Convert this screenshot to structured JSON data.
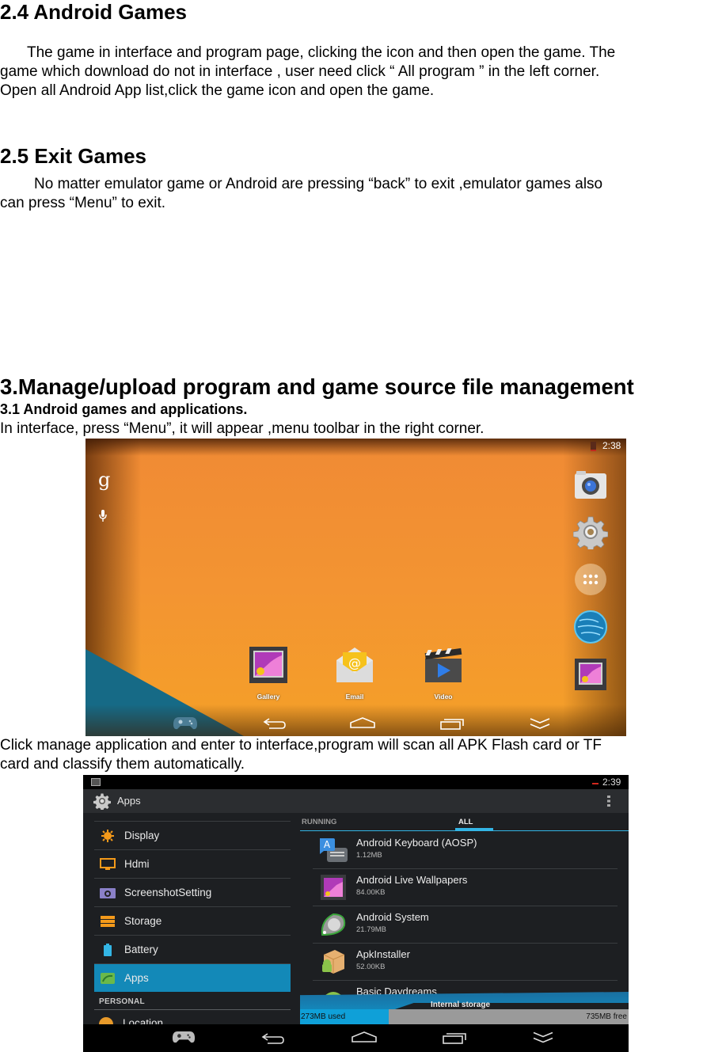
{
  "section_2_4": {
    "heading": "2.4 Android Games",
    "lines": [
      "The game in interface and program page, clicking the icon and then open the game. The",
      "game which download do not in interface , user need click “ All program ” in the left corner.",
      "Open all Android App list,click the game icon and open the game."
    ]
  },
  "section_2_5": {
    "heading": "2.5 Exit Games",
    "lines": [
      "No matter emulator game or Android are pressing “back” to exit ,emulator games also",
      "can press “Menu” to exit."
    ]
  },
  "section_3": {
    "heading": "3.Manage/upload program and game source file management",
    "sub_heading": "3.1 Android games and applications.",
    "intro": "In interface, press “Menu”, it will appear ,menu toolbar in the right corner.",
    "after_shot1_lines": [
      "Click manage application and enter to interface,program will scan all APK Flash card or TF",
      "card and classify them automatically."
    ]
  },
  "screenshot_home": {
    "status_time": "2:38",
    "left_icons": [
      "google-search-icon",
      "mic-icon"
    ],
    "dock": [
      {
        "label": "Gallery",
        "icon": "gallery-icon"
      },
      {
        "label": "Email",
        "icon": "email-icon"
      },
      {
        "label": "Video",
        "icon": "video-icon"
      }
    ],
    "side_icons": [
      "camera-icon",
      "settings-icon",
      "all-apps-icon",
      "browser-globe-icon",
      "gallery-icon"
    ],
    "nav_icons": [
      "gamepad-icon",
      "back-icon",
      "home-icon",
      "recents-icon",
      "menu-collapse-icon"
    ],
    "colors": {
      "wallpaper": "#f39432",
      "teal": "#166a86"
    }
  },
  "screenshot_settings": {
    "status_time": "2:39",
    "actionbar_title": "Apps",
    "settings_items": [
      {
        "label": "Display",
        "icon": "display-brightness-icon",
        "active": false
      },
      {
        "label": "Hdmi",
        "icon": "monitor-icon",
        "active": false
      },
      {
        "label": "ScreenshotSetting",
        "icon": "camera-icon",
        "active": false
      },
      {
        "label": "Storage",
        "icon": "storage-icon",
        "active": false
      },
      {
        "label": "Battery",
        "icon": "battery-icon",
        "active": false
      },
      {
        "label": "Apps",
        "icon": "apps-icon",
        "active": true
      }
    ],
    "personal_header": "PERSONAL",
    "partial_item": "Location",
    "tabs": [
      {
        "label": "RUNNING",
        "active": false
      },
      {
        "label": "ALL",
        "active": true
      }
    ],
    "apps": [
      {
        "name": "Android Keyboard (AOSP)",
        "size": "1.12MB",
        "icon": "keyboard-icon"
      },
      {
        "name": "Android Live Wallpapers",
        "size": "84.00KB",
        "icon": "wallpaper-icon"
      },
      {
        "name": "Android System",
        "size": "21.79MB",
        "icon": "android-system-icon"
      },
      {
        "name": "ApkInstaller",
        "size": "52.00KB",
        "icon": "apk-installer-icon"
      },
      {
        "name": "Basic Daydreams",
        "size": "",
        "icon": "android-icon"
      }
    ],
    "storage": {
      "label": "Internal storage",
      "used": "273MB used",
      "free": "735MB free",
      "used_fraction": 0.27
    },
    "nav_icons": [
      "gamepad-icon",
      "back-icon",
      "home-icon",
      "recents-icon",
      "menu-collapse-icon"
    ],
    "colors": {
      "accent": "#33b5e5",
      "selected": "#1389b8"
    }
  }
}
